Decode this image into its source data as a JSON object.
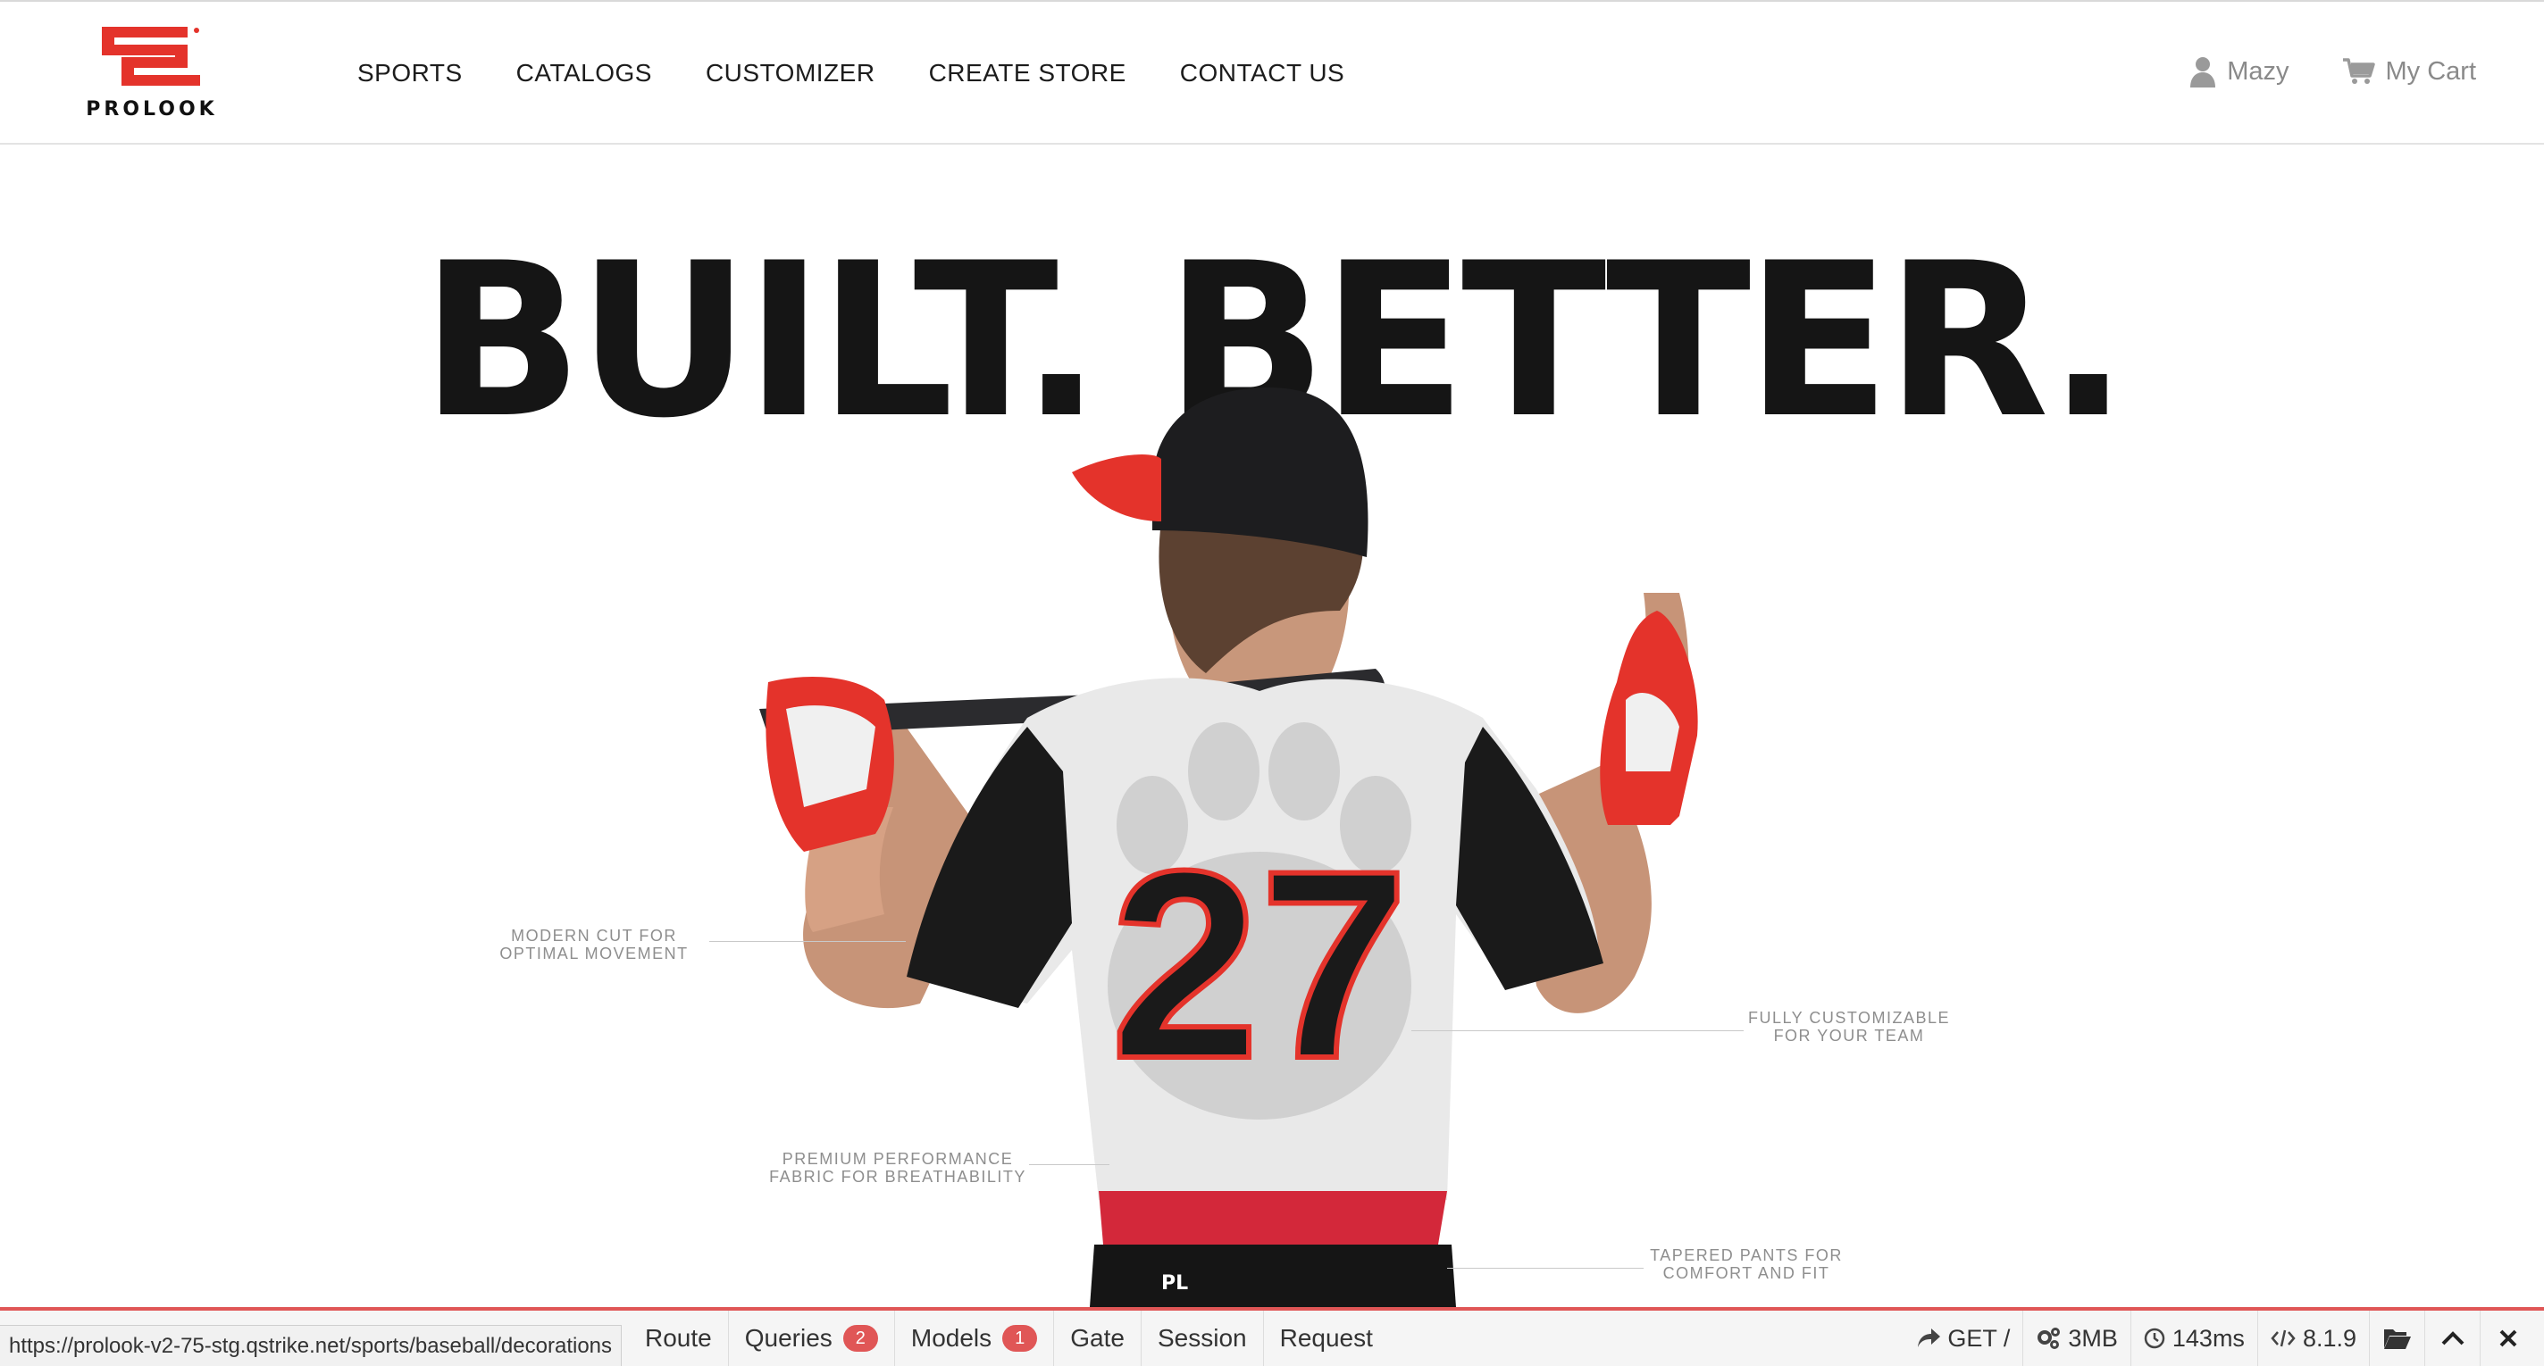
{
  "brand": {
    "name": "PROLOOK",
    "accent_color": "#e4332b"
  },
  "nav": {
    "items": [
      {
        "label": "SPORTS"
      },
      {
        "label": "CATALOGS"
      },
      {
        "label": "CUSTOMIZER"
      },
      {
        "label": "CREATE STORE"
      },
      {
        "label": "CONTACT US"
      }
    ]
  },
  "user": {
    "name": "Mazy",
    "cart_label": "My Cart",
    "user_icon": "user-icon",
    "cart_icon": "cart-icon"
  },
  "hero": {
    "title": "BUILT. BETTER.",
    "jersey_number": "27",
    "callouts": {
      "cut": [
        "MODERN CUT FOR",
        "OPTIMAL MOVEMENT"
      ],
      "custom": [
        "FULLY CUSTOMIZABLE",
        "FOR YOUR TEAM"
      ],
      "fabric": [
        "PREMIUM PERFORMANCE",
        "FABRIC FOR BREATHABILITY"
      ],
      "pants": [
        "TAPERED PANTS FOR",
        "COMFORT AND FIT"
      ]
    }
  },
  "debugbar": {
    "accent": "#e05656",
    "tabs": [
      {
        "label": "Route"
      },
      {
        "label": "Queries",
        "badge": "2"
      },
      {
        "label": "Models",
        "badge": "1"
      },
      {
        "label": "Gate"
      },
      {
        "label": "Session"
      },
      {
        "label": "Request"
      }
    ],
    "method": "GET /",
    "memory": "3MB",
    "time": "143ms",
    "version": "8.1.9"
  },
  "status_bar": {
    "url": "https://prolook-v2-75-stg.qstrike.net/sports/baseball/decorations"
  }
}
